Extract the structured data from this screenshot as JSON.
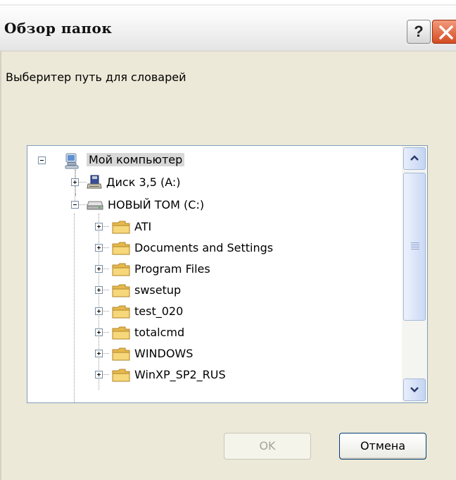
{
  "dialog": {
    "title": "Обзор папок",
    "help_label": "?",
    "prompt": "Выберитер путь для словарей"
  },
  "tree": {
    "root": {
      "label": "Мой компьютер",
      "icon": "my-computer-icon",
      "selected": true
    },
    "drive_a": {
      "label": "Диск 3,5 (A:)",
      "icon": "floppy-drive-icon"
    },
    "drive_c": {
      "label": "НОВЫЙ ТОМ (C:)",
      "icon": "hard-drive-icon"
    },
    "folders": [
      {
        "label": "ATI"
      },
      {
        "label": "Documents and Settings"
      },
      {
        "label": "Program Files"
      },
      {
        "label": "swsetup"
      },
      {
        "label": "test_020"
      },
      {
        "label": "totalcmd"
      },
      {
        "label": "WINDOWS"
      },
      {
        "label": "WinXP_SP2_RUS"
      }
    ]
  },
  "buttons": {
    "ok_label": "OK",
    "cancel_label": "Отмена"
  },
  "colors": {
    "close_red": "#d44c22",
    "selection_bg": "#d8d8d8",
    "folder_yellow": "#f6c95a",
    "dialog_bg": "#ece9d8"
  }
}
